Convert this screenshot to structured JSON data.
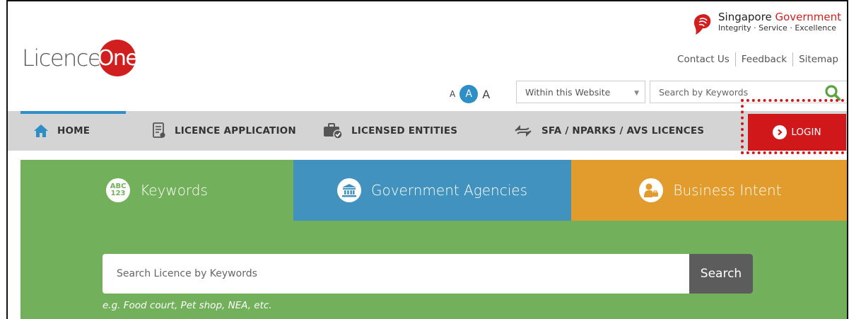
{
  "brand": {
    "logo_prefix": "Licence",
    "logo_circle": "One"
  },
  "gov": {
    "title_a": "Singapore ",
    "title_b": "Government",
    "motto": "Integrity · Service · Excellence"
  },
  "toplinks": [
    "Contact Us",
    "Feedback",
    "Sitemap"
  ],
  "font_size": {
    "small": "A",
    "medium": "A",
    "large": "A"
  },
  "search_scope": {
    "value": "Within this Website"
  },
  "top_search": {
    "placeholder": "Search by Keywords"
  },
  "nav": [
    {
      "label": "HOME",
      "icon": "home-icon"
    },
    {
      "label": "LICENCE APPLICATION",
      "icon": "document-icon"
    },
    {
      "label": "LICENSED ENTITIES",
      "icon": "briefcase-check-icon"
    },
    {
      "label": "SFA / NPARKS / AVS LICENCES",
      "icon": "exchange-arrows-icon"
    }
  ],
  "login": {
    "label": "LOGIN"
  },
  "tabs": [
    {
      "label": "Keywords",
      "icon_text": "ABC\n123",
      "icon": "abc-123-icon"
    },
    {
      "label": "Government Agencies",
      "icon": "government-building-icon"
    },
    {
      "label": "Business Intent",
      "icon": "businessman-icon"
    }
  ],
  "keyword_search": {
    "placeholder": "Search Licence by Keywords",
    "button": "Search",
    "hint": "e.g. Food court, Pet shop, NEA, etc."
  },
  "colors": {
    "accent": "#2e8fc7",
    "login_red": "#d0181b",
    "green": "#72b05b",
    "blue": "#4192bf",
    "orange": "#e29b2d"
  }
}
